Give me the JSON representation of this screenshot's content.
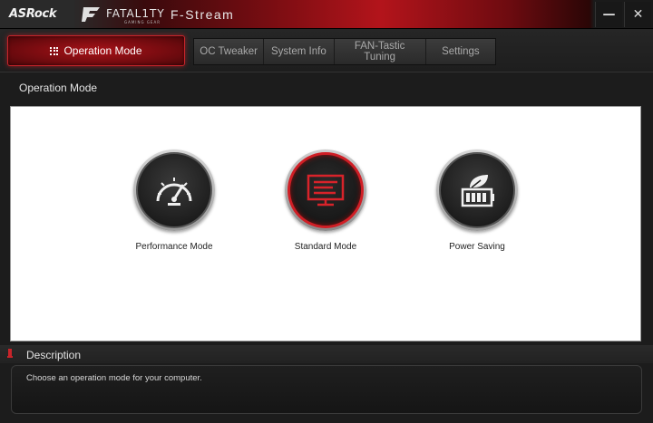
{
  "titlebar": {
    "brand": "ASRock",
    "fatal_text": "FATAL1TY",
    "fatal_sub": "GAMING GEAR",
    "app_title": "F-Stream",
    "minimize_icon": "minimize-icon",
    "close_icon": "close-icon"
  },
  "tabs": {
    "active": "Operation Mode",
    "items": [
      {
        "label": "OC Tweaker"
      },
      {
        "label": "System Info"
      },
      {
        "label": "FAN-Tastic Tuning"
      },
      {
        "label": "Settings"
      }
    ]
  },
  "main": {
    "section_title": "Operation Mode",
    "modes": [
      {
        "label": "Performance Mode",
        "icon": "speedometer-icon"
      },
      {
        "label": "Standard Mode",
        "icon": "monitor-icon",
        "selected": true
      },
      {
        "label": "Power Saving",
        "icon": "leaf-battery-icon"
      }
    ]
  },
  "description": {
    "title": "Description",
    "text": "Choose an operation mode for your computer."
  },
  "colors": {
    "accent": "#c8242a",
    "background": "#1c1c1c",
    "panel": "#ffffff"
  }
}
